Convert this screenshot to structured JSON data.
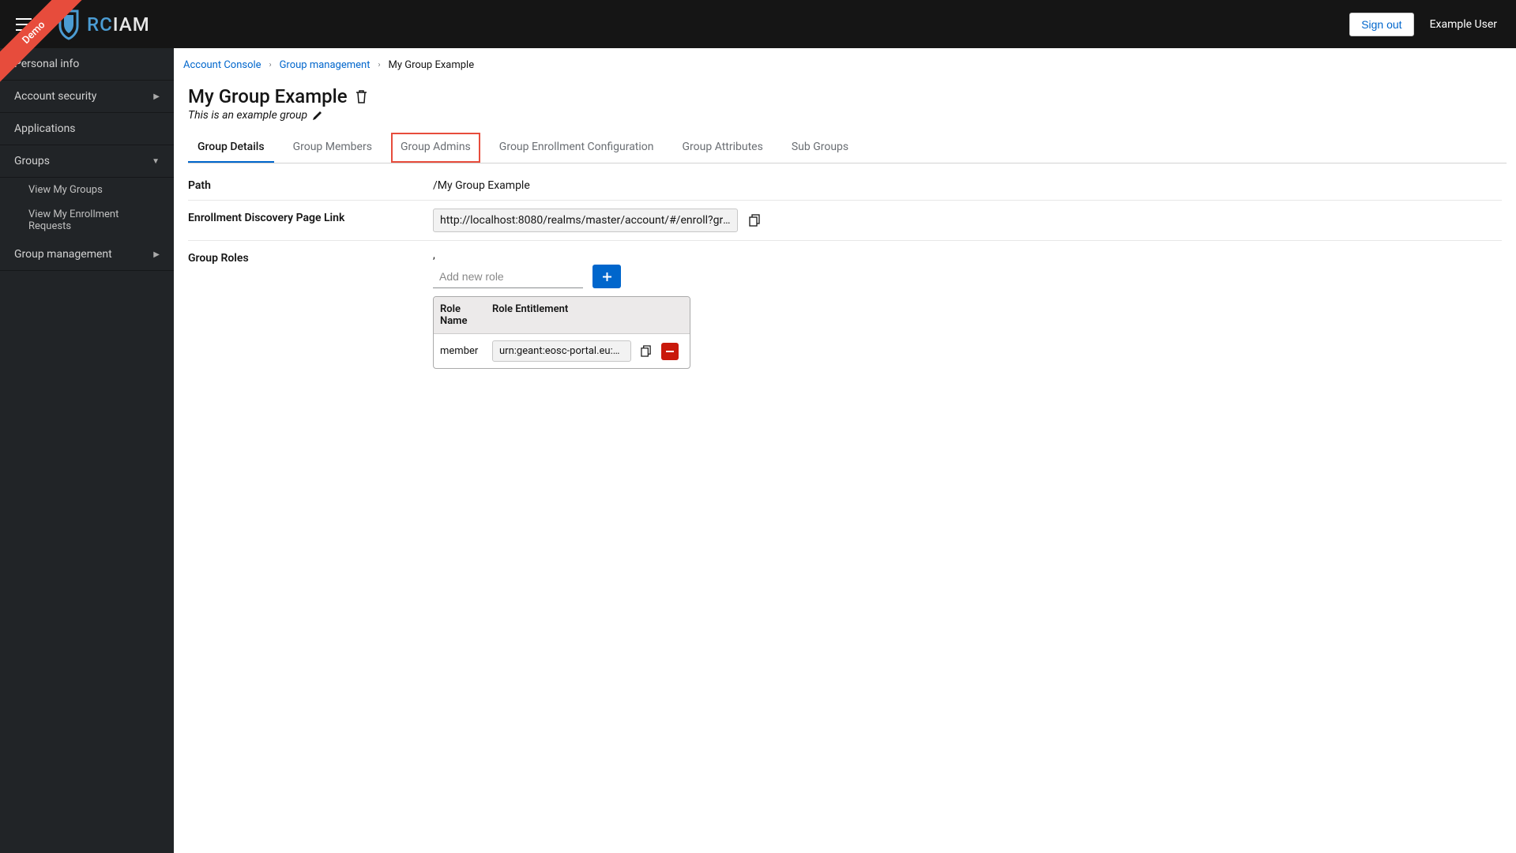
{
  "header": {
    "demo_label": "Demo",
    "logo_rc": "RC",
    "logo_iam": "IAM",
    "signout": "Sign out",
    "user": "Example User"
  },
  "sidebar": {
    "items": [
      {
        "label": "Personal info",
        "expandable": false
      },
      {
        "label": "Account security",
        "expandable": true,
        "open": false
      },
      {
        "label": "Applications",
        "expandable": false
      },
      {
        "label": "Groups",
        "expandable": true,
        "open": true,
        "children": [
          {
            "label": "View My Groups"
          },
          {
            "label": "View My Enrollment Requests"
          }
        ]
      },
      {
        "label": "Group management",
        "expandable": true,
        "open": false
      }
    ]
  },
  "breadcrumb": {
    "items": [
      {
        "label": "Account Console",
        "link": true
      },
      {
        "label": "Group management",
        "link": true
      },
      {
        "label": "My Group Example",
        "link": false
      }
    ]
  },
  "page": {
    "title": "My Group Example",
    "subtitle": "This is an example group"
  },
  "tabs": [
    {
      "label": "Group Details",
      "active": true
    },
    {
      "label": "Group Members"
    },
    {
      "label": "Group Admins",
      "highlighted": true
    },
    {
      "label": "Group Enrollment Configuration"
    },
    {
      "label": "Group Attributes"
    },
    {
      "label": "Sub Groups"
    }
  ],
  "details": {
    "path_label": "Path",
    "path_value": "/My Group Example",
    "enroll_label": "Enrollment Discovery Page Link",
    "enroll_value": "http://localhost:8080/realms/master/account/#/enroll?groupPath= ...",
    "roles_label": "Group Roles",
    "roles_top_text": ",",
    "add_role_placeholder": "Add new role",
    "roles_table": {
      "col1": "Role Name",
      "col2": "Role Entitlement",
      "rows": [
        {
          "name": "member",
          "entitlement": "urn:geant:eosc-portal.eu:grou ..."
        }
      ]
    }
  }
}
